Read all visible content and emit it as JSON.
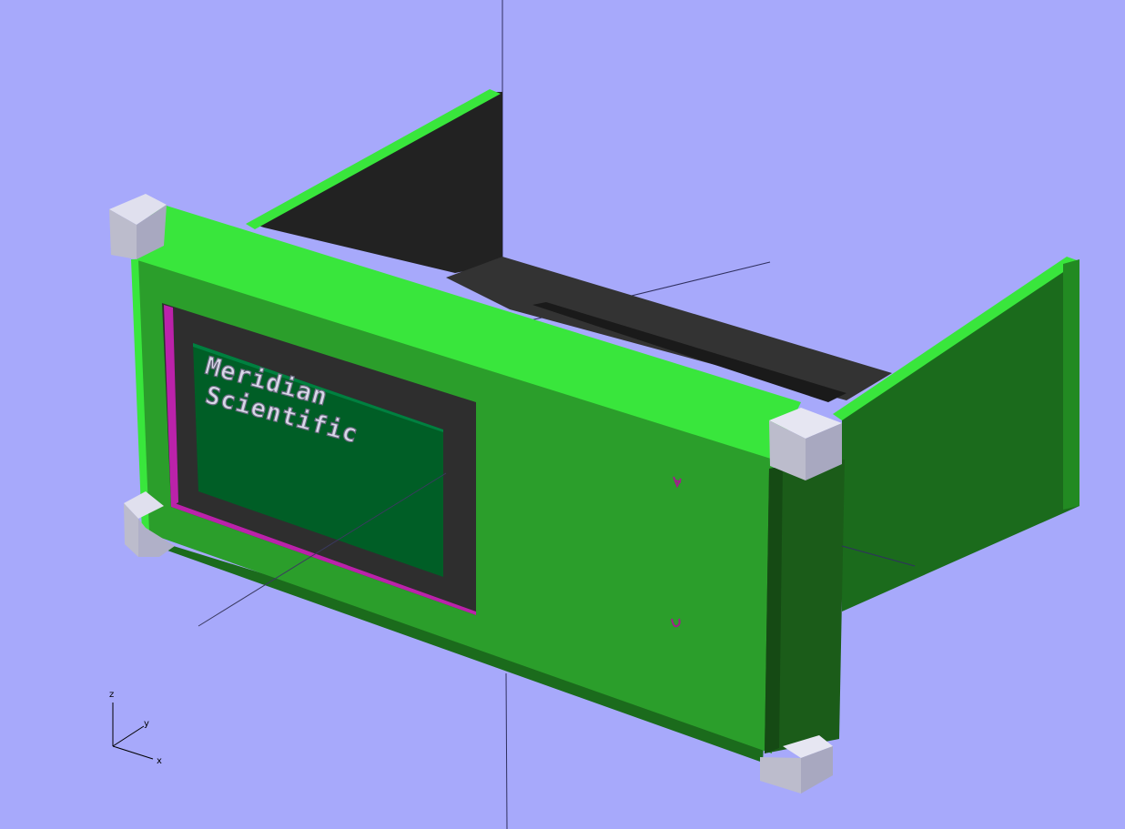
{
  "viewport": {
    "background_color": "#a7a9fb"
  },
  "model": {
    "panel_label_line1": "Meridian",
    "panel_label_line2": "Scientific",
    "colors": {
      "face": "#2b9e2b",
      "face_top": "#39e63c",
      "side": "#1b5c19",
      "interior": "#222222",
      "screen": "#005e26",
      "corner": "#cccce0"
    }
  },
  "axes_gizmo": {
    "z_label": "z",
    "y_label": "y",
    "x_label": "x"
  }
}
